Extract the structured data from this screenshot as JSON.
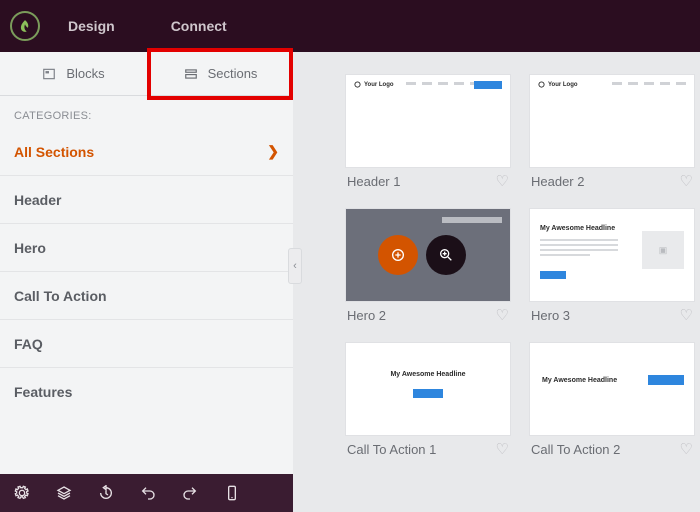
{
  "topnav": {
    "design": "Design",
    "connect": "Connect"
  },
  "tabs": {
    "blocks": "Blocks",
    "sections": "Sections",
    "active": "sections"
  },
  "sidebar": {
    "categories_label": "CATEGORIES:",
    "items": [
      {
        "label": "All Sections",
        "selected": true
      },
      {
        "label": "Header"
      },
      {
        "label": "Hero"
      },
      {
        "label": "Call To Action"
      },
      {
        "label": "FAQ"
      },
      {
        "label": "Features"
      }
    ]
  },
  "gallery": {
    "cards": [
      {
        "name": "Header 1",
        "kind": "header",
        "logo_text": "Your Logo"
      },
      {
        "name": "Header 2",
        "kind": "header",
        "logo_text": "Your Logo"
      },
      {
        "name": "Hero 2",
        "kind": "hero2",
        "highlighted": true
      },
      {
        "name": "Hero 3",
        "kind": "hero3",
        "headline": "My Awesome Headline"
      },
      {
        "name": "Call To Action 1",
        "kind": "cta1",
        "headline": "My Awesome Headline"
      },
      {
        "name": "Call To Action 2",
        "kind": "cta2",
        "headline": "My Awesome Headline"
      }
    ]
  },
  "icons": {
    "add": "add-icon",
    "zoom": "zoom-icon",
    "toolbar": [
      "settings",
      "layers",
      "history",
      "undo",
      "redo",
      "mobile"
    ]
  }
}
